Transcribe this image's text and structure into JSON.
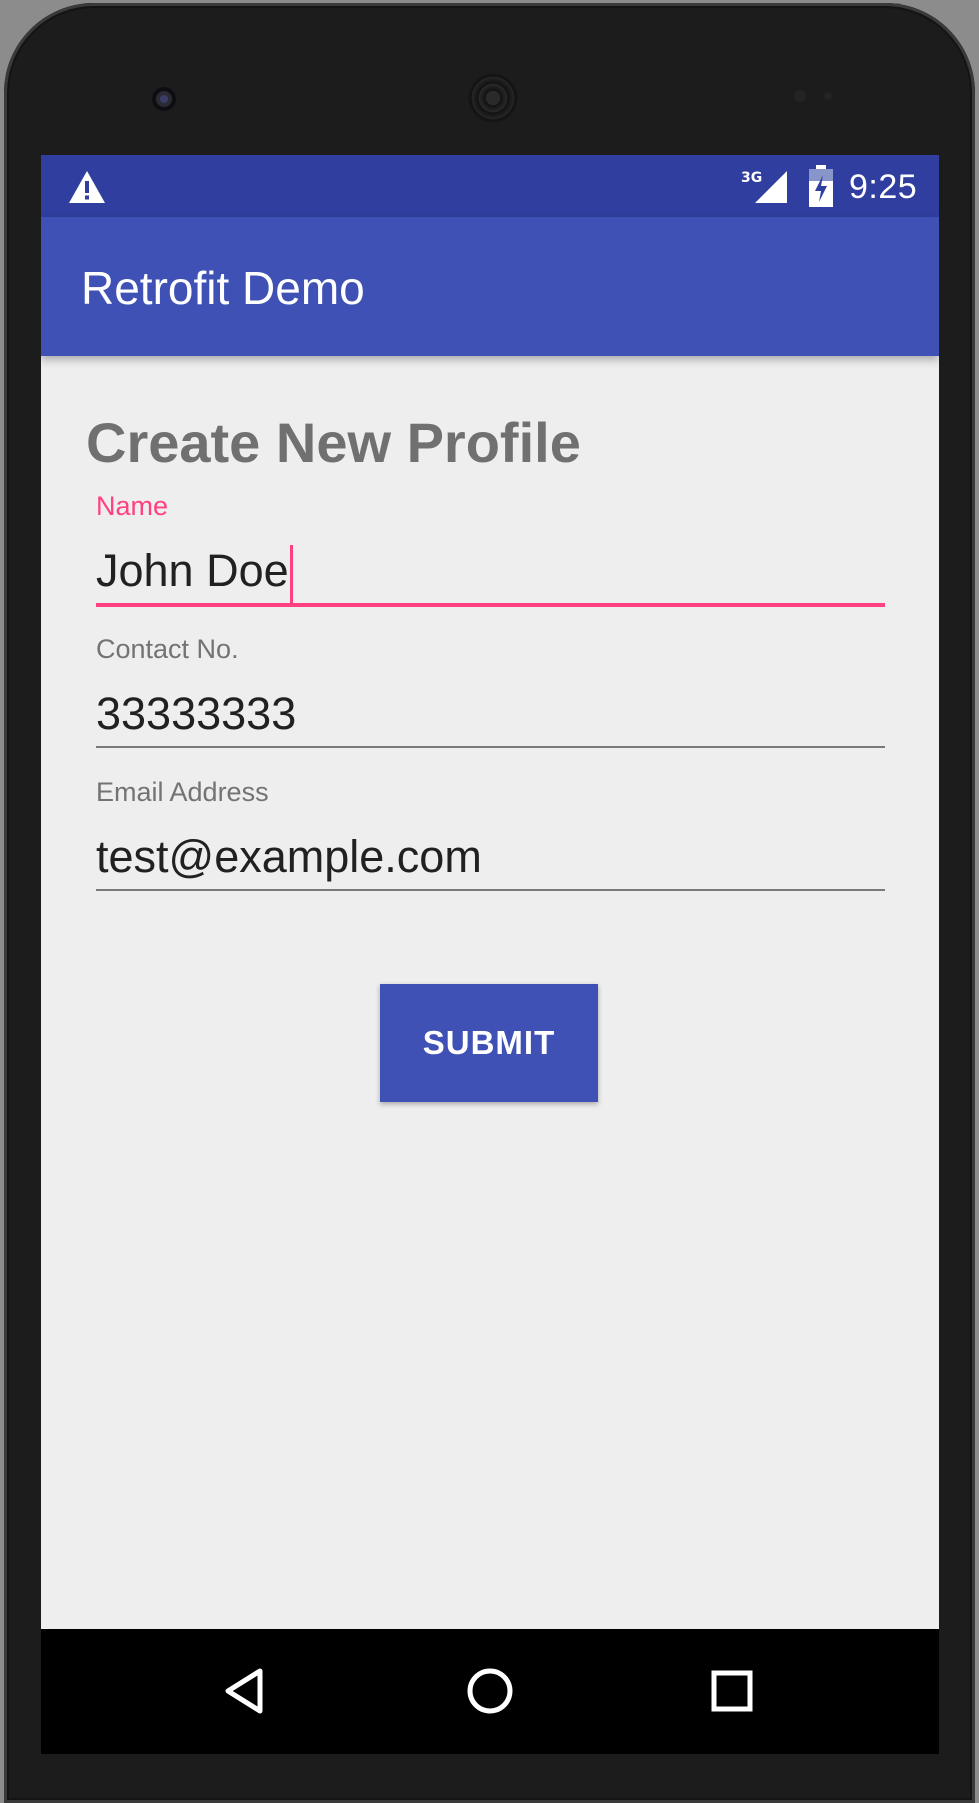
{
  "status_bar": {
    "time": "9:25",
    "network_type": "3G",
    "icons": [
      "warning-icon",
      "signal-icon",
      "battery-charging-icon"
    ]
  },
  "app_bar": {
    "title": "Retrofit Demo"
  },
  "form": {
    "title": "Create New Profile",
    "fields": [
      {
        "label": "Name",
        "value": "John Doe",
        "focused": true
      },
      {
        "label": "Contact No.",
        "value": "33333333",
        "focused": false
      },
      {
        "label": "Email Address",
        "value": "test@example.com",
        "focused": false
      }
    ],
    "submit_label": "SUBMIT"
  },
  "nav_bar": {
    "buttons": [
      "back-icon",
      "home-icon",
      "recents-icon"
    ]
  },
  "colors": {
    "primary": "#3f51b5",
    "primary_dark": "#303f9f",
    "accent": "#ff4081",
    "background": "#eeeeee"
  }
}
